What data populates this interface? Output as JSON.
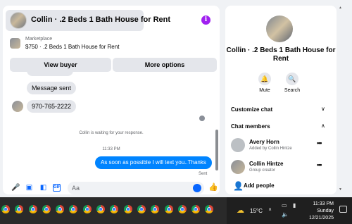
{
  "chat": {
    "title": "Collin · .2 Beds 1 Bath House for Rent",
    "info_icon": "i",
    "listing": {
      "label": "Marketplace",
      "price_title": "$750 · .2 Beds 1 Bath House for Rent"
    },
    "buttons": {
      "view_buyer": "View buyer",
      "more_options": "More options"
    },
    "messages": {
      "incoming_1": "Message sent",
      "incoming_2": "970-765-2222",
      "waiting": "Collin is waiting for your response.",
      "time": "11:33 PM",
      "outgoing": "As soon as possible I will text you..Thanks",
      "status": "Sent"
    },
    "composer": {
      "placeholder": "Aa",
      "gif": "GIF",
      "icons": [
        "mic-icon",
        "photo-icon",
        "sticker-icon",
        "gif-icon",
        "emoji-icon",
        "thumbs-up-icon"
      ]
    }
  },
  "info": {
    "name": "Collin · .2 Beds 1 Bath House for Rent",
    "actions": {
      "mute": "Mute",
      "search": "Search"
    },
    "sections": {
      "customize": "Customize chat",
      "members": "Chat members"
    },
    "members": [
      {
        "name": "Avery Horn",
        "sub": "Added by Collin Hintze"
      },
      {
        "name": "Collin Hintze",
        "sub": "Group creator"
      }
    ],
    "add_people": "Add people"
  },
  "taskbar": {
    "app_icon": "chrome-icon",
    "app_count": 16,
    "weather": "15°C",
    "time": "11:33 PM",
    "day": "Sunday",
    "date": "12/21/2025"
  },
  "colors": {
    "accent": "#0866ff",
    "outgoing_bubble": "#0084ff",
    "info_purple": "#a020f0"
  }
}
